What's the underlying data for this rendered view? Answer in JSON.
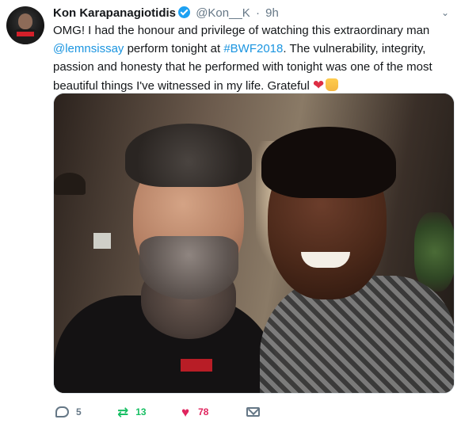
{
  "tweet": {
    "author_name": "Kon Karapanagiotidis",
    "handle": "@Kon__K",
    "separator": "·",
    "time": "9h",
    "text_parts": {
      "p1": "OMG! I had the honour and privilege of watching this extraordinary man",
      "mention": "@lemnsissay",
      "p2": " perform tonight at ",
      "hashtag": "#BWF2018",
      "p3": ".  The vulnerability, integrity, passion and honesty that he performed with tonight was one of the most beautiful things I've witnessed in my life. Grateful "
    },
    "emoji": [
      "heart",
      "folded-hands"
    ]
  },
  "actions": {
    "replies": "5",
    "retweets": "13",
    "likes": "78"
  },
  "colors": {
    "link": "#1b95e0",
    "retweet": "#17bf63",
    "like": "#e0245e",
    "muted": "#657786"
  }
}
